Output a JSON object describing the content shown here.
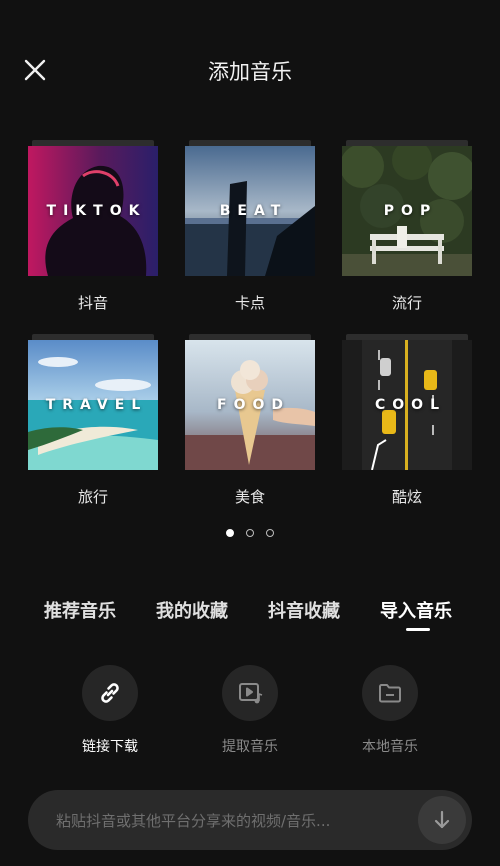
{
  "header": {
    "title": "添加音乐",
    "close_icon": "close-icon"
  },
  "categories": [
    {
      "label": "抖音",
      "tag": "TIKTOK"
    },
    {
      "label": "卡点",
      "tag": "BEAT"
    },
    {
      "label": "流行",
      "tag": "POP"
    },
    {
      "label": "旅行",
      "tag": "TRAVEL"
    },
    {
      "label": "美食",
      "tag": "FOOD"
    },
    {
      "label": "酷炫",
      "tag": "COOL"
    }
  ],
  "pagination": {
    "pages": 3,
    "active": 1
  },
  "tabs": [
    {
      "label": "推荐音乐",
      "active": false
    },
    {
      "label": "我的收藏",
      "active": false
    },
    {
      "label": "抖音收藏",
      "active": false
    },
    {
      "label": "导入音乐",
      "active": true
    }
  ],
  "import_actions": [
    {
      "label": "链接下载",
      "icon": "link-icon",
      "enabled": true
    },
    {
      "label": "提取音乐",
      "icon": "video-music-icon",
      "enabled": false
    },
    {
      "label": "本地音乐",
      "icon": "folder-icon",
      "enabled": false
    }
  ],
  "link_input": {
    "placeholder": "粘贴抖音或其他平台分享来的视频/音乐...",
    "submit_icon": "arrow-down-icon"
  },
  "colors": {
    "background": "#111111",
    "surface": "#262626",
    "input_bg": "#2a2a2a",
    "text_primary": "#ffffff",
    "text_disabled": "#8a8a8a"
  }
}
